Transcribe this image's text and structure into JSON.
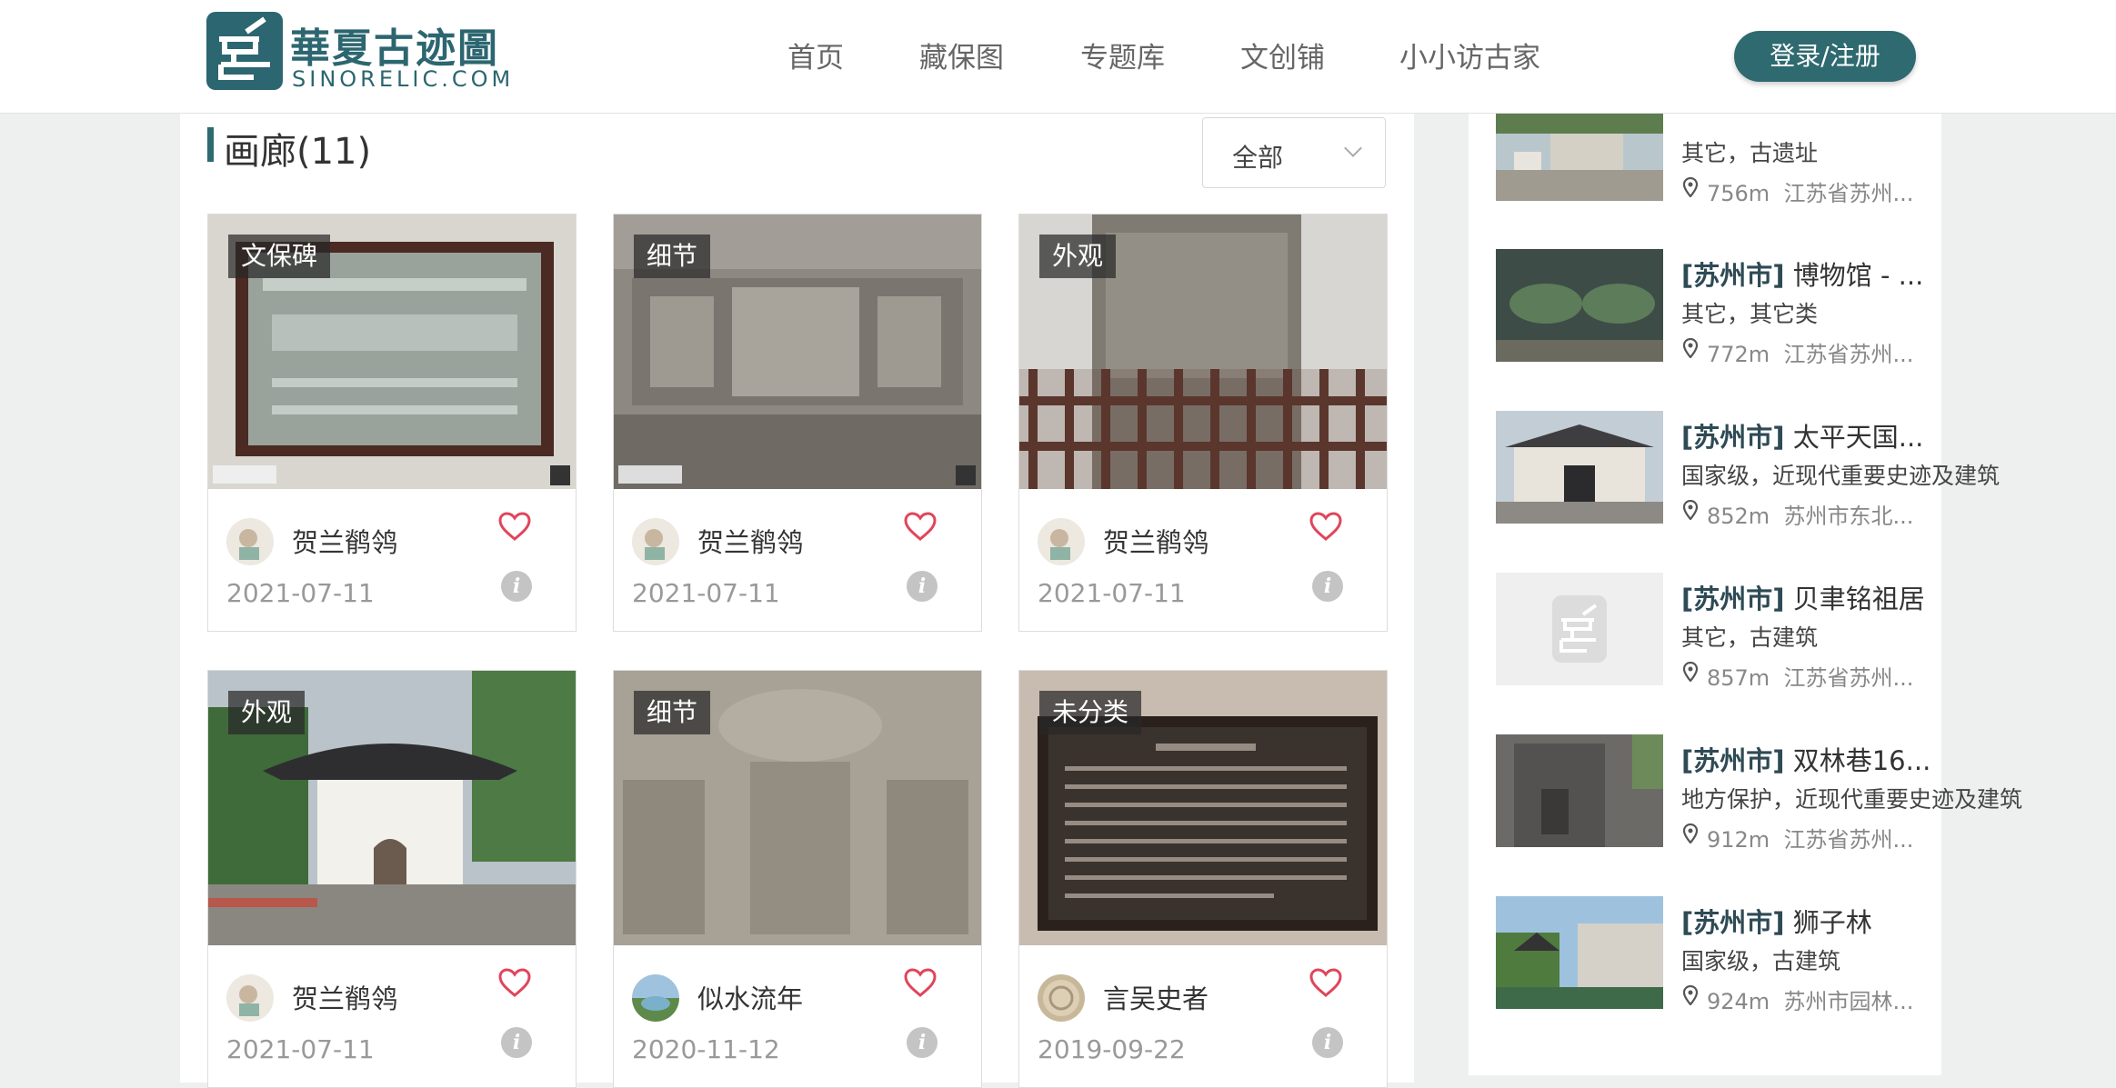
{
  "logo": {
    "cn": "華夏古迹圖",
    "en": "SINORELIC.COM"
  },
  "nav": {
    "items": [
      "首页",
      "藏保图",
      "专题库",
      "文创铺",
      "小小访古家"
    ],
    "login_label": "登录/注册"
  },
  "gallery": {
    "title": "画廊(11)",
    "filter_value": "全部",
    "cards": [
      {
        "tag": "文保碑",
        "author": "贺兰鹡鸰",
        "date": "2021-07-11"
      },
      {
        "tag": "细节",
        "author": "贺兰鹡鸰",
        "date": "2021-07-11"
      },
      {
        "tag": "外观",
        "author": "贺兰鹡鸰",
        "date": "2021-07-11"
      },
      {
        "tag": "外观",
        "author": "贺兰鹡鸰",
        "date": "2021-07-11"
      },
      {
        "tag": "细节",
        "author": "似水流年",
        "date": "2020-11-12"
      },
      {
        "tag": "未分类",
        "author": "言吴史者",
        "date": "2019-09-22"
      }
    ]
  },
  "nearby": [
    {
      "prefix": "",
      "name": "",
      "category": "其它，古遗址",
      "distance": "756m",
      "address": "江苏省苏州..."
    },
    {
      "prefix": "[苏州市]",
      "name": "博物馆 - ...",
      "category": "其它，其它类",
      "distance": "772m",
      "address": "江苏省苏州..."
    },
    {
      "prefix": "[苏州市]",
      "name": "太平天国...",
      "category": "国家级，近现代重要史迹及建筑",
      "distance": "852m",
      "address": "苏州市东北..."
    },
    {
      "prefix": "[苏州市]",
      "name": "贝聿铭祖居",
      "category": "其它，古建筑",
      "distance": "857m",
      "address": "江苏省苏州..."
    },
    {
      "prefix": "[苏州市]",
      "name": "双林巷16...",
      "category": "地方保护，近现代重要史迹及建筑",
      "distance": "912m",
      "address": "江苏省苏州..."
    },
    {
      "prefix": "[苏州市]",
      "name": "狮子林",
      "category": "国家级，古建筑",
      "distance": "924m",
      "address": "苏州市园林..."
    }
  ],
  "colors": {
    "brand": "#2e6a70",
    "heart": "#e0455a"
  }
}
